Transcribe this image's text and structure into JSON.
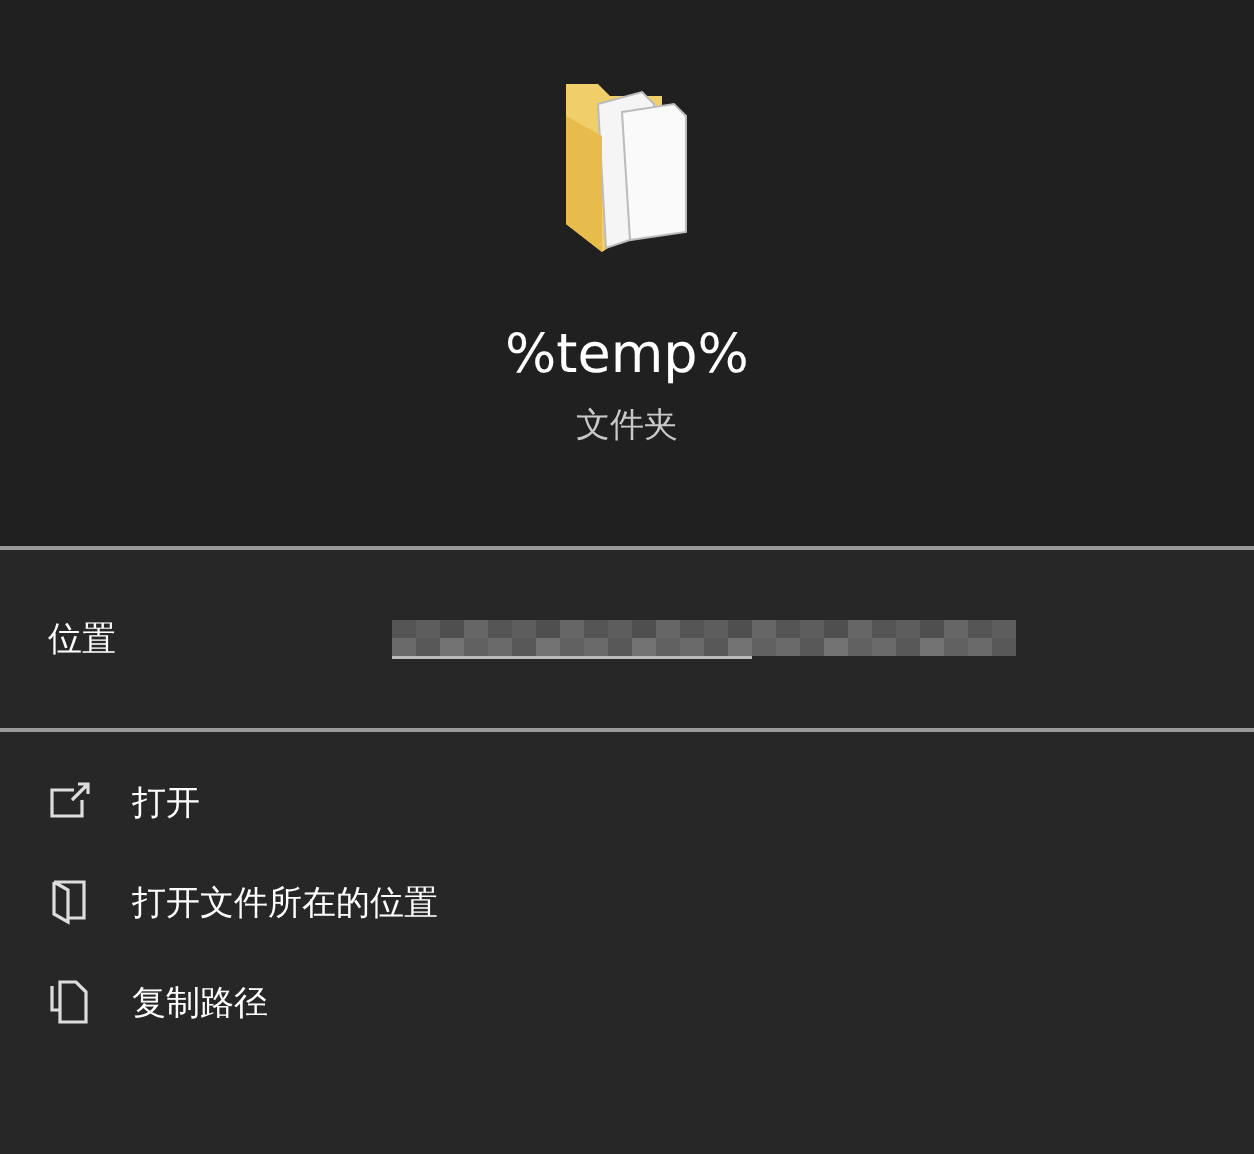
{
  "item": {
    "name": "%temp%",
    "type": "文件夹"
  },
  "details": [
    {
      "label": "位置",
      "kind": "redacted"
    }
  ],
  "actions": [
    {
      "label": "打开",
      "kind": "open"
    },
    {
      "label": "打开文件所在的位置",
      "kind": "location"
    },
    {
      "label": "复制路径",
      "kind": "copy"
    }
  ]
}
